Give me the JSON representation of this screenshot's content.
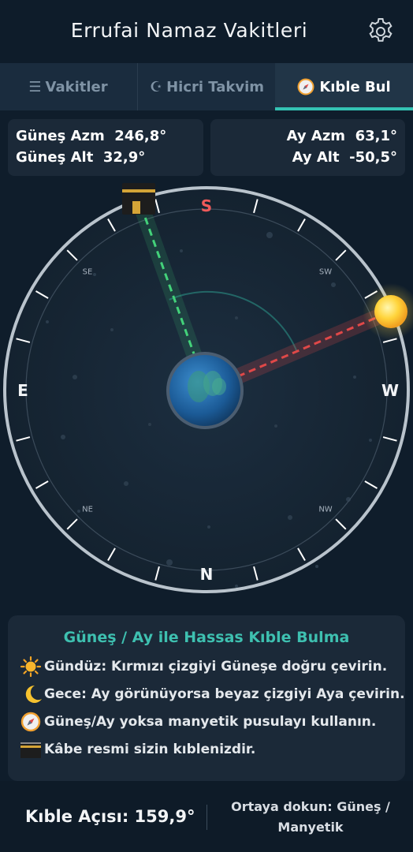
{
  "header": {
    "title": "Errufai Namaz Vakitleri",
    "settings_icon": "gear-icon"
  },
  "tabs": [
    {
      "icon": "☰",
      "label": "Vakitler",
      "active": false
    },
    {
      "icon": "☪",
      "label": "Hicri Takvim",
      "active": false
    },
    {
      "icon": "compass-icon",
      "label": "Kıble Bul",
      "active": true
    }
  ],
  "sun_info": {
    "azimuth": "Güneş Azm  246,8°",
    "altitude": "Güneş Alt  32,9°"
  },
  "moon_info": {
    "azimuth": "Ay Azm  63,1°",
    "altitude": "Ay Alt  -50,5°"
  },
  "compass": {
    "cardinals": {
      "south": "S",
      "east": "E",
      "west": "W",
      "north": "N"
    },
    "intercardinals": {
      "se": "SE",
      "sw": "SW",
      "ne": "NE",
      "nw": "NW"
    },
    "colors": {
      "qibla_line": "#43d27a",
      "sun_line": "#e04848",
      "ring": "#b9c3cc",
      "south": "#ef5a5a"
    }
  },
  "info": {
    "title": "Güneş / Ay ile Hassas Kıble Bulma",
    "lines": [
      {
        "icon": "sun-icon",
        "text": "Gündüz: Kırmızı çizgiyi Güneşe doğru çevirin."
      },
      {
        "icon": "moon-icon",
        "text": "Gece: Ay görünüyorsa beyaz çizgiyi Aya çevirin."
      },
      {
        "icon": "compass-icon",
        "text": "Güneş/Ay yoksa manyetik pusulayı kullanın."
      },
      {
        "icon": "kaaba-icon",
        "text": "Kâbe resmi sizin kıblenizdir."
      }
    ]
  },
  "footer": {
    "angle": "Kıble Açısı: 159,9°",
    "tap_line1": "Ortaya dokun: Güneş /",
    "tap_line2": "Manyetik"
  }
}
